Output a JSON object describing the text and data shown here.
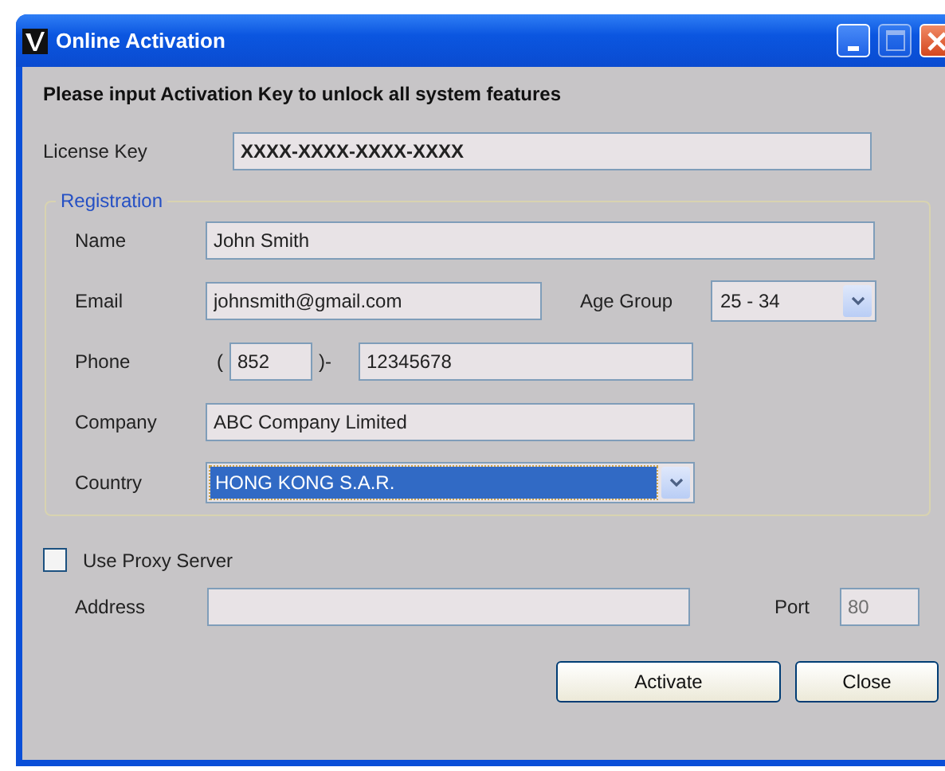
{
  "window": {
    "title": "Online Activation"
  },
  "heading": "Please input Activation Key to unlock all system features",
  "license": {
    "label": "License Key",
    "value": "XXXX-XXXX-XXXX-XXXX"
  },
  "registration": {
    "legend": "Registration",
    "name": {
      "label": "Name",
      "value": "John Smith"
    },
    "email": {
      "label": "Email",
      "value": "johnsmith@gmail.com"
    },
    "age_group": {
      "label": "Age Group",
      "value": "25 - 34"
    },
    "phone": {
      "label": "Phone",
      "open": "(",
      "area_code": "852",
      "separator": ")-",
      "number": "12345678"
    },
    "company": {
      "label": "Company",
      "value": "ABC Company Limited"
    },
    "country": {
      "label": "Country",
      "value": "HONG KONG S.A.R.",
      "selected": true
    }
  },
  "proxy": {
    "label": "Use Proxy Server",
    "checked": false,
    "address": {
      "label": "Address"
    },
    "port": {
      "label": "Port",
      "value": "80",
      "disabled": true
    }
  },
  "buttons": [
    {
      "label": "Activate"
    },
    {
      "label": "Close"
    }
  ]
}
